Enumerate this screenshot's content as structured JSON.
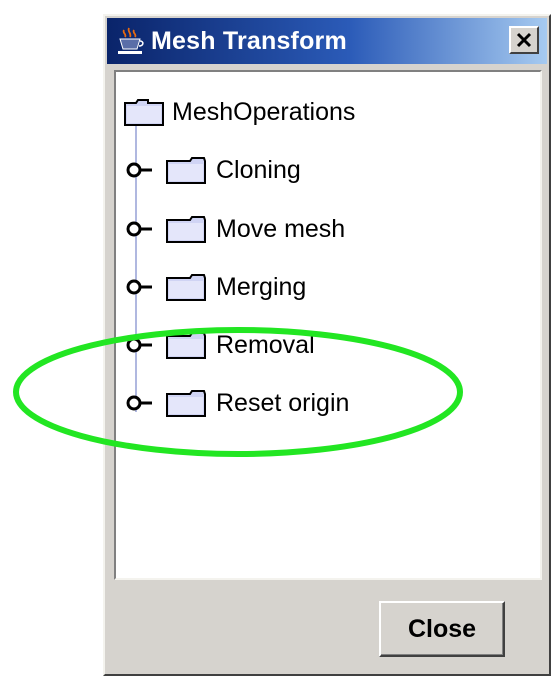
{
  "window": {
    "title": "Mesh Transform",
    "title_icon": "java-cup-icon",
    "close_icon": "close-x-icon"
  },
  "tree": {
    "root": {
      "label": "MeshOperations",
      "icon": "folder-icon"
    },
    "children": [
      {
        "label": "Cloning",
        "icon": "folder-icon",
        "expander": "collapsed-handle-icon"
      },
      {
        "label": "Move mesh",
        "icon": "folder-icon",
        "expander": "collapsed-handle-icon"
      },
      {
        "label": "Merging",
        "icon": "folder-icon",
        "expander": "collapsed-handle-icon"
      },
      {
        "label": "Removal",
        "icon": "folder-icon",
        "expander": "collapsed-handle-icon"
      },
      {
        "label": "Reset origin",
        "icon": "folder-icon",
        "expander": "collapsed-handle-icon"
      }
    ]
  },
  "footer": {
    "close_label": "Close"
  },
  "annotation": {
    "highlight_color": "#22e622",
    "highlighted_item": "Reset origin"
  },
  "colors": {
    "titlebar_start": "#0a246a",
    "titlebar_end": "#a6caf0",
    "dialog_bg": "#d6d3ce",
    "folder_fill": "#d0d4f4",
    "folder_stroke": "#000000"
  }
}
